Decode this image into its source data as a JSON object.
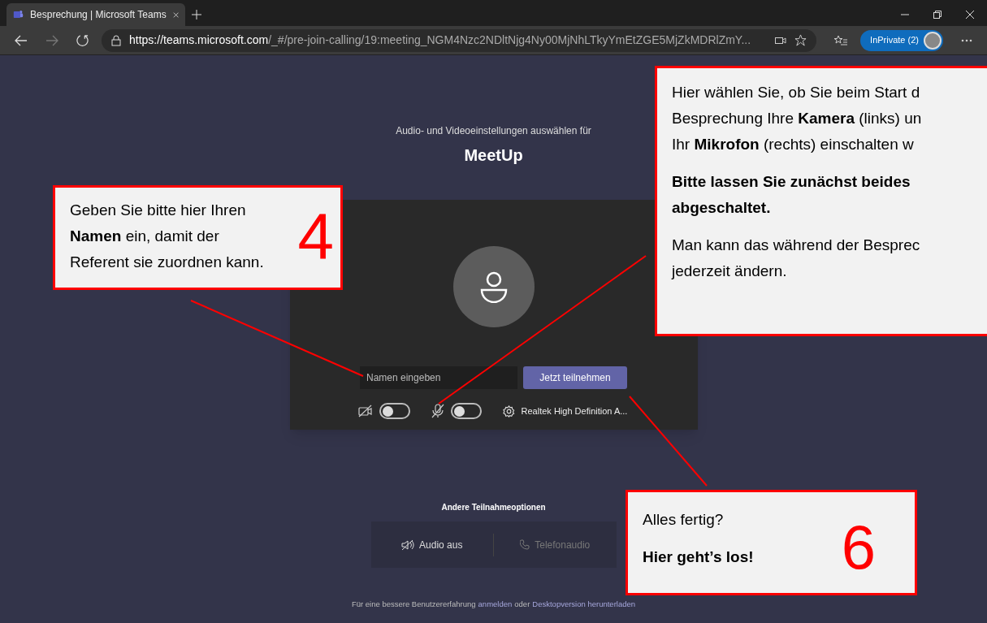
{
  "browser": {
    "tab_title": "Besprechung | Microsoft Teams",
    "url_host": "https://teams.microsoft.com",
    "url_path": "/_#/pre-join-calling/19:meeting_NGM4Nzc2NDltNjg4Ny00MjNhLTkyYmEtZGE5MjZkMDRlZmY...",
    "profile": "InPrivate (2)"
  },
  "prejoin": {
    "subtitle": "Audio- und Videoeinstellungen auswählen für",
    "meeting_title": "MeetUp",
    "name_field": {
      "placeholder": "Namen eingeben"
    },
    "join_button": "Jetzt teilnehmen",
    "toggles": [
      {
        "kind": "camera",
        "on": false
      },
      {
        "kind": "microphone",
        "on": false
      }
    ],
    "device": "Realtek High Definition A..."
  },
  "other_options": {
    "title": "Andere Teilnahmeoptionen",
    "options": [
      {
        "kind": "audio-off",
        "label": "Audio aus",
        "disabled": false
      },
      {
        "kind": "phone",
        "label": "Telefonaudio",
        "disabled": true
      }
    ]
  },
  "footer": {
    "text": "Für eine bessere Benutzererfahrung",
    "link1": "anmelden",
    "middle": "oder",
    "link2": "Desktopversion herunterladen"
  },
  "callouts": [
    {
      "kind": "name",
      "paragraphs": [
        [
          "Geben Sie bitte hier Ihren",
          "**Namen** ein, damit der",
          "Referent sie zuordnen kann."
        ]
      ],
      "number": "4"
    },
    {
      "kind": "devices",
      "paragraphs": [
        [
          "Hier wählen Sie, ob Sie beim Start d",
          "Besprechung Ihre **Kamera** (links) un",
          "Ihr **Mikrofon** (rechts) einschalten w"
        ],
        [
          "**Bitte lassen Sie zunächst beides**",
          "**abgeschaltet.**"
        ],
        [
          "Man kann das während der Besprec",
          "jederzeit ändern."
        ]
      ]
    },
    {
      "kind": "join",
      "paragraphs": [
        [
          "Alles fertig?"
        ],
        [
          "**Hier geht’s los!**"
        ]
      ],
      "number": "6"
    }
  ]
}
